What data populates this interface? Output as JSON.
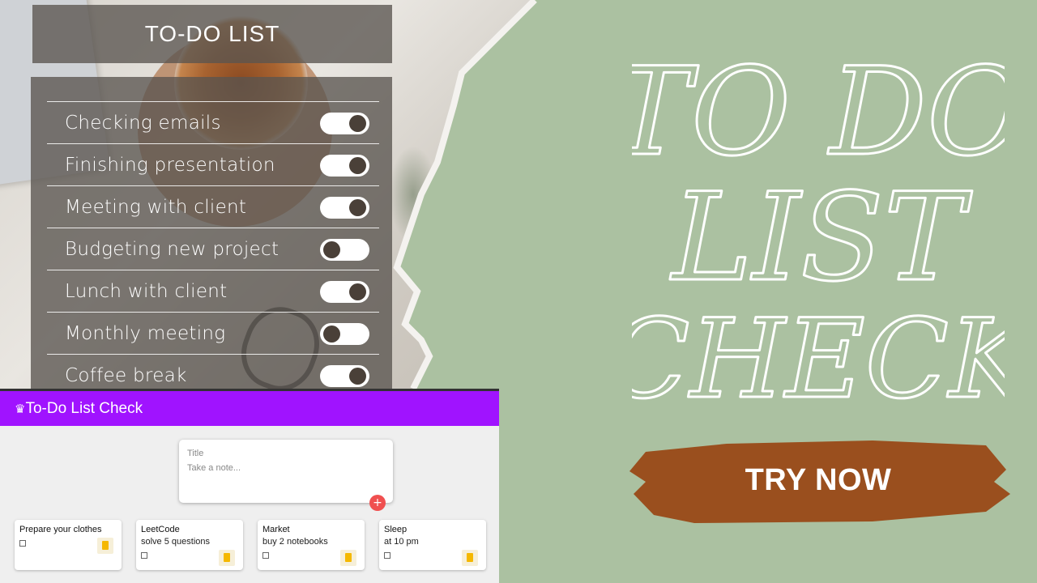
{
  "todo_panel": {
    "title": "TO-DO LIST",
    "items": [
      {
        "label": "Checking emails",
        "done": true
      },
      {
        "label": "Finishing presentation",
        "done": true
      },
      {
        "label": "Meeting with client",
        "done": true
      },
      {
        "label": "Budgeting new project",
        "done": false
      },
      {
        "label": "Lunch with client",
        "done": true
      },
      {
        "label": "Monthly meeting",
        "done": false
      },
      {
        "label": "Coffee break",
        "done": true
      }
    ]
  },
  "app": {
    "title": "To-Do List Check",
    "title_icon": "crown-icon",
    "note_form": {
      "title_placeholder": "Title",
      "content_placeholder": "Take a note...",
      "add_label": "+"
    },
    "notes": [
      {
        "title": "Prepare your clothes",
        "content": ""
      },
      {
        "title": "LeetCode",
        "content": "solve 5 questions"
      },
      {
        "title": "Market",
        "content": "buy 2 notebooks"
      },
      {
        "title": "Sleep",
        "content": "at 10 pm"
      }
    ],
    "accent": "#a013ff"
  },
  "headline": {
    "lines": [
      "TO DO",
      "LIST",
      "CHECK"
    ]
  },
  "cta": {
    "label": "TRY NOW",
    "color": "#9a4f1e"
  },
  "colors": {
    "background": "#abc1a1"
  }
}
